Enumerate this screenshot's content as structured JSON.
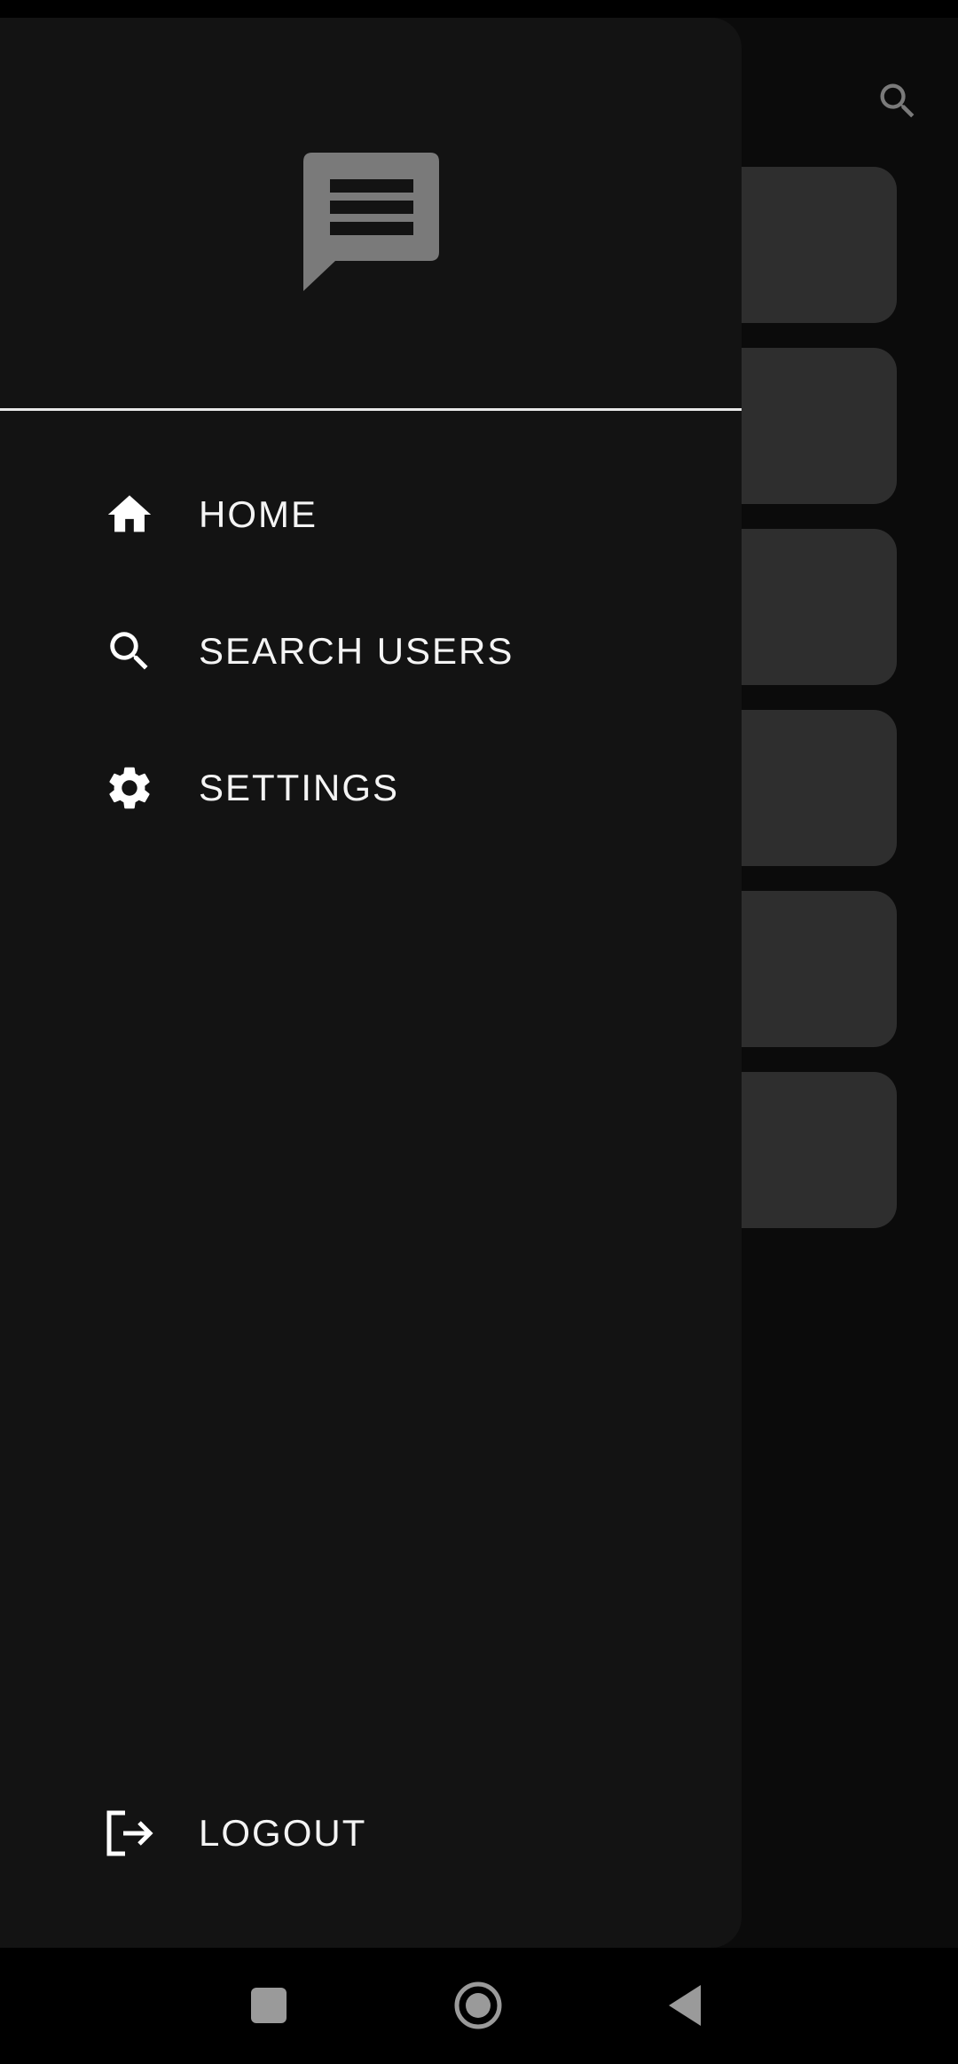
{
  "drawer": {
    "items": [
      {
        "label": "HOME",
        "icon": "home-icon"
      },
      {
        "label": "SEARCH USERS",
        "icon": "search-icon"
      },
      {
        "label": "SETTINGS",
        "icon": "gear-icon"
      }
    ],
    "logout": {
      "label": "LOGOUT",
      "icon": "logout-icon"
    },
    "logo_icon": "chat-bubble-icon"
  },
  "background": {
    "search_icon": "search-icon",
    "card_count": 6
  },
  "system_nav": {
    "buttons": [
      "recents-icon",
      "home-circle-icon",
      "back-icon"
    ]
  },
  "colors": {
    "drawer_bg": "#131313",
    "screen_bg": "#0b0b0b",
    "card_bg": "#2e2e2e",
    "logo": "#7a7a7a",
    "text": "#f4f4f4"
  }
}
